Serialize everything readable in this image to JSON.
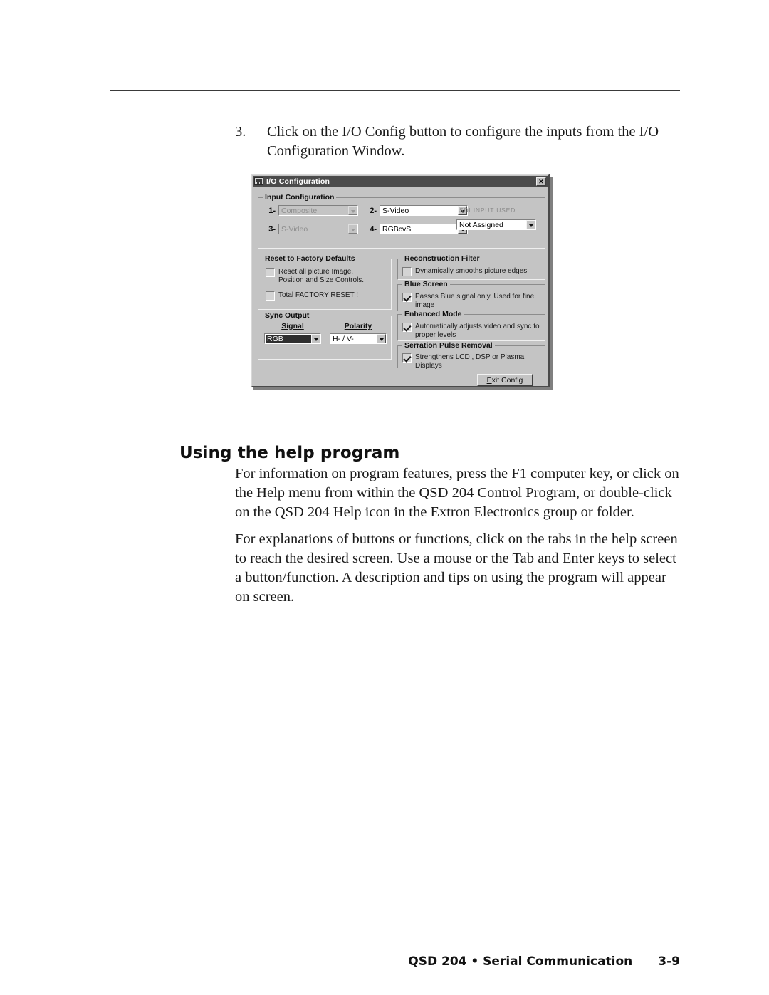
{
  "step": {
    "number": "3.",
    "text": "Click on the I/O Config button to configure the inputs from the I/O Configuration Window."
  },
  "dialog": {
    "title": "I/O Configuration",
    "close_label": "✕",
    "input_configuration": {
      "legend": "Input Configuration",
      "inputs": [
        {
          "label": "1-",
          "value": "Composite",
          "disabled": true
        },
        {
          "label": "2-",
          "value": "S-Video",
          "disabled": false
        },
        {
          "label": "3-",
          "value": "S-Video",
          "disabled": true
        },
        {
          "label": "4-",
          "value": "RGBcvS",
          "disabled": false
        }
      ],
      "sdi_label": "SDI INPUT USED",
      "sdi_value": "Not Assigned"
    },
    "reset_to_factory_defaults": {
      "legend": "Reset to Factory Defaults",
      "items": [
        {
          "label": "Reset all picture Image,\nPosition and Size Controls.",
          "checked": false
        },
        {
          "label": "Total FACTORY RESET !",
          "checked": false
        }
      ]
    },
    "sync_output": {
      "legend": "Sync Output",
      "signal_header": "Signal",
      "signal_value": "RGB",
      "polarity_header": "Polarity",
      "polarity_value": "H- / V-"
    },
    "reconstruction_filter": {
      "legend": "Reconstruction Filter",
      "label": "Dynamically smooths picture edges",
      "checked": false
    },
    "blue_screen": {
      "legend": "Blue Screen",
      "label": "Passes Blue signal only. Used for fine image\nadjustment.",
      "checked": true
    },
    "enhanced_mode": {
      "legend": "Enhanced Mode",
      "label": "Automatically adjusts video and sync to\nproper levels",
      "checked": true
    },
    "serration_pulse_removal": {
      "legend": "Serration Pulse Removal",
      "label": "Strengthens LCD , DSP or Plasma  Displays",
      "checked": true
    },
    "exit_button": {
      "accel": "E",
      "rest": "xit Config"
    }
  },
  "section": {
    "heading": "Using the help program",
    "paragraph1": "For information on program features, press the F1 computer key, or click on the Help menu from within the QSD 204 Control Program, or double-click on the QSD 204 Help icon in the Extron Electronics group or folder.",
    "paragraph2": "For explanations of buttons or functions, click on the tabs in the help screen to reach the desired screen.  Use a mouse or the Tab and Enter keys to select a button/function.  A description and tips on using the program will appear on screen."
  },
  "footer": {
    "title": "QSD 204 • Serial Communication",
    "page": "3-9"
  }
}
